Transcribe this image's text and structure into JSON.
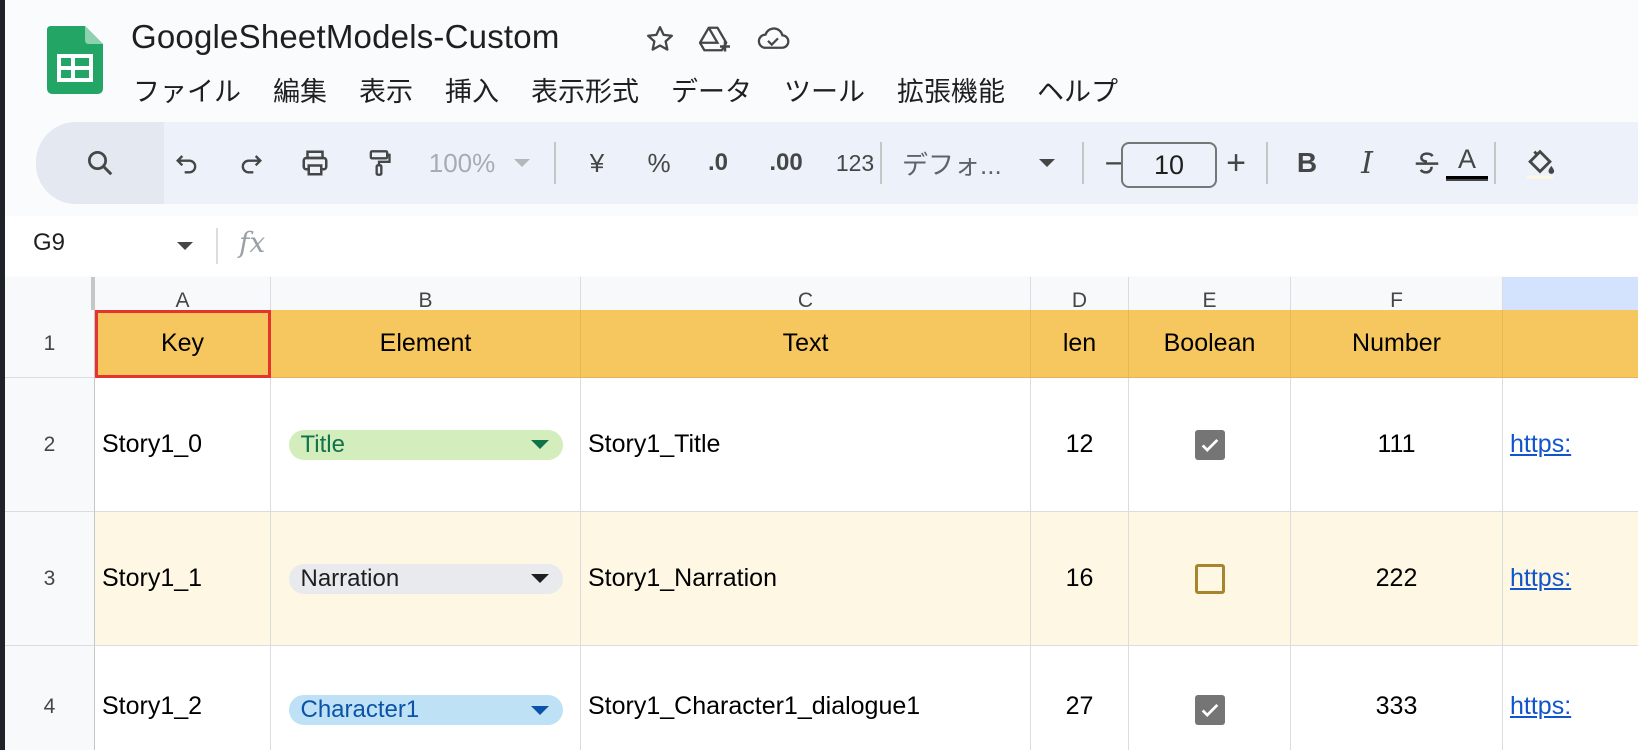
{
  "app": {
    "title": "GoogleSheetModels-Custom",
    "title_icons": [
      "star-icon",
      "drive-add-icon",
      "cloud-saved-icon"
    ]
  },
  "menu": [
    "ファイル",
    "編集",
    "表示",
    "挿入",
    "表示形式",
    "データ",
    "ツール",
    "拡張機能",
    "ヘルプ"
  ],
  "toolbar": {
    "zoom": "100%",
    "currency": "¥",
    "percent": "%",
    "decrease_decimal": ".0",
    "increase_decimal": ".00",
    "format_number": "123",
    "font": "デフォ...",
    "font_size": "10",
    "minus": "−",
    "plus": "+",
    "bold": "B",
    "italic": "I",
    "text_color": "A"
  },
  "formula_bar": {
    "name_box": "G9",
    "fx": "fx"
  },
  "columns": [
    "A",
    "B",
    "C",
    "D",
    "E",
    "F"
  ],
  "header_row": {
    "number": "1",
    "cells": [
      "Key",
      "Element",
      "Text",
      "len",
      "Boolean",
      "Number"
    ]
  },
  "rows": [
    {
      "number": "2",
      "key": "Story1_0",
      "element": "Title",
      "element_color": "green",
      "text": "Story1_Title",
      "len": "12",
      "boolean": true,
      "number_value": "111",
      "link": "https:"
    },
    {
      "number": "3",
      "key": "Story1_1",
      "element": "Narration",
      "element_color": "grey",
      "text": "Story1_Narration",
      "len": "16",
      "boolean": false,
      "number_value": "222",
      "link": "https:"
    },
    {
      "number": "4",
      "key": "Story1_2",
      "element": "Character1",
      "element_color": "blue",
      "text": "Story1_Character1_dialogue1",
      "len": "27",
      "boolean": true,
      "number_value": "333",
      "link": "https:"
    }
  ],
  "colors": {
    "header_fill": "#f6c75e",
    "alt_row_fill": "#fef7e3",
    "selection_outline": "#e3342f",
    "sheets_green": "#23a566"
  }
}
